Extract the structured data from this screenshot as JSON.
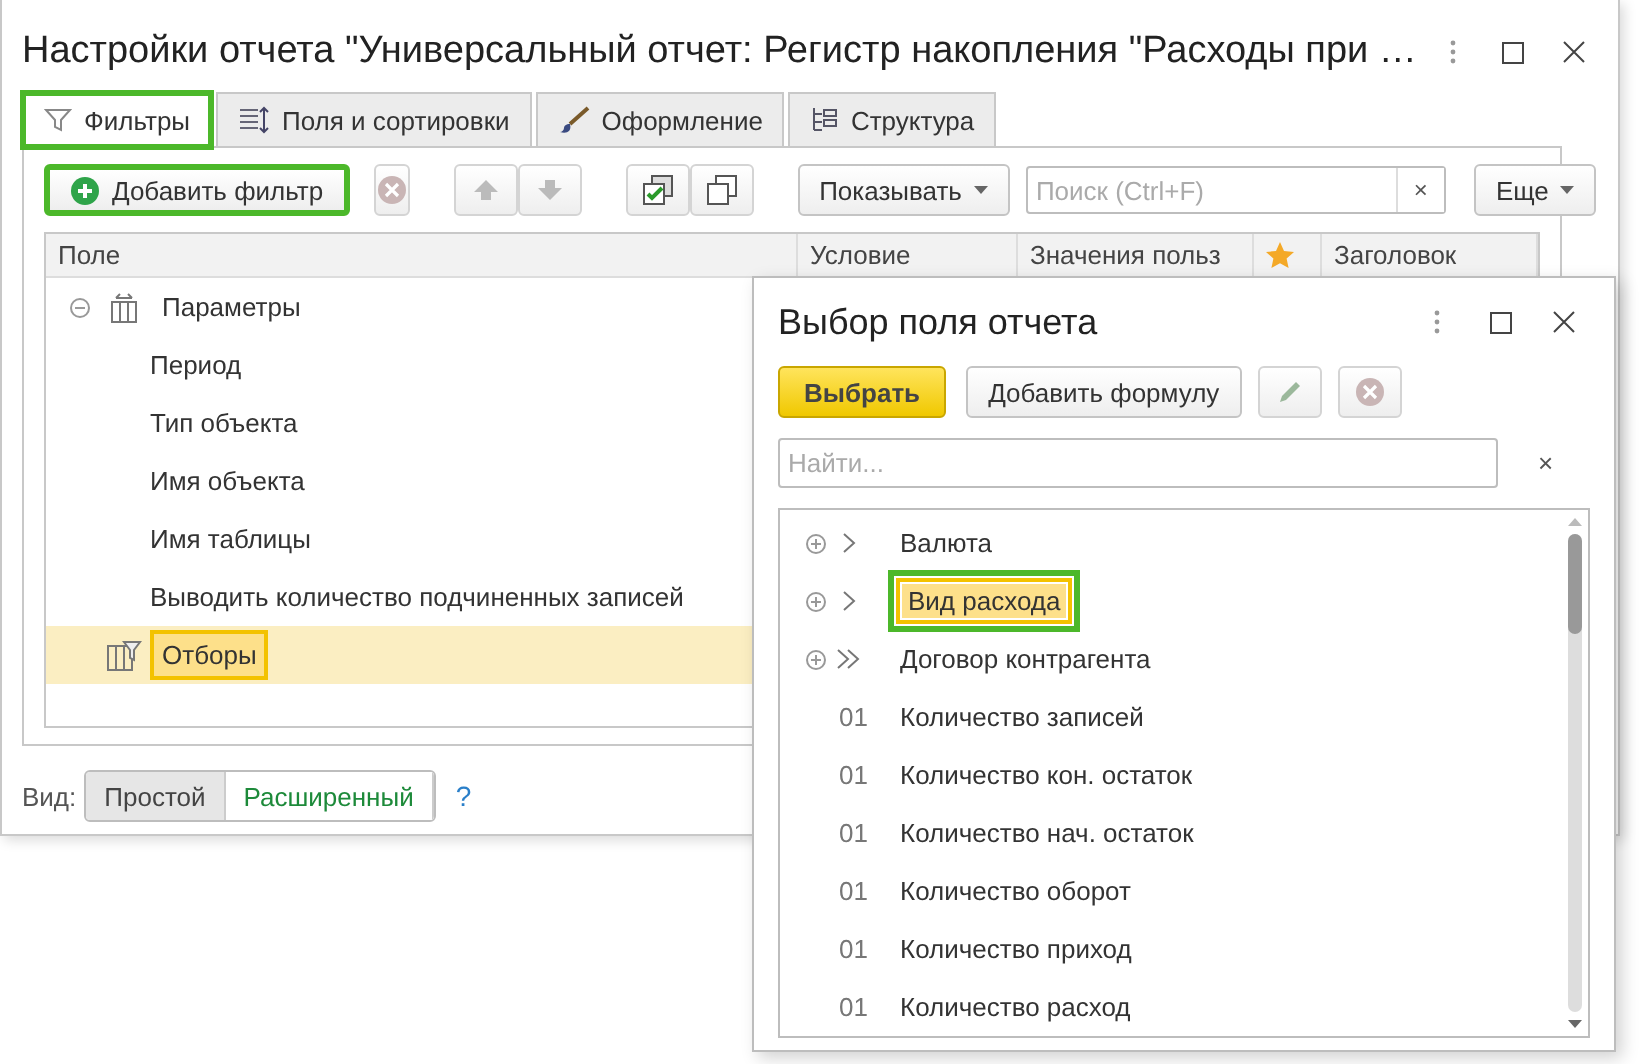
{
  "window": {
    "title": "Настройки отчета \"Универсальный отчет: Регистр накопления \"Расходы при …"
  },
  "tabs": [
    {
      "label": "Фильтры",
      "selected": true,
      "highlighted": true
    },
    {
      "label": "Поля и сортировки",
      "selected": false,
      "highlighted": false
    },
    {
      "label": "Оформление",
      "selected": false,
      "highlighted": false
    },
    {
      "label": "Структура",
      "selected": false,
      "highlighted": false
    }
  ],
  "toolbar": {
    "add_filter": {
      "label": "Добавить фильтр",
      "highlighted": true
    },
    "show": "Показывать",
    "search": {
      "placeholder": "Поиск (Ctrl+F)",
      "clear": "×"
    },
    "more": "Еще"
  },
  "table": {
    "columns": [
      "Поле",
      "Условие",
      "Значения польз",
      "Заголовок"
    ],
    "rows": [
      {
        "label": "Параметры",
        "expanded": true,
        "selected": false,
        "children": [
          {
            "label": "Период",
            "selected": false
          },
          {
            "label": "Тип объекта",
            "selected": false
          },
          {
            "label": "Имя объекта",
            "selected": false
          },
          {
            "label": "Имя таблицы",
            "selected": false
          },
          {
            "label": "Выводить количество подчиненных записей",
            "selected": false
          }
        ]
      },
      {
        "label": "Отборы",
        "selected": true
      }
    ]
  },
  "view": {
    "label": "Вид:",
    "options": [
      {
        "label": "Простой",
        "selected": true
      },
      {
        "label": "Расширенный",
        "selected": false
      }
    ],
    "help": "?"
  },
  "dialog": {
    "title": "Выбор поля отчета",
    "choose": "Выбрать",
    "add_formula": "Добавить формулу",
    "search": {
      "placeholder": "Найти...",
      "clear": "×"
    },
    "items": [
      {
        "kind": "ref",
        "label": "Валюта",
        "selected": false,
        "highlighted": false
      },
      {
        "kind": "ref",
        "label": "Вид расхода",
        "selected": true,
        "highlighted": true
      },
      {
        "kind": "link",
        "label": "Договор контрагента",
        "selected": false,
        "highlighted": false
      },
      {
        "kind": "number",
        "prefix": "01",
        "label": "Количество записей",
        "selected": false,
        "highlighted": false
      },
      {
        "kind": "number",
        "prefix": "01",
        "label": "Количество кон. остаток",
        "selected": false,
        "highlighted": false
      },
      {
        "kind": "number",
        "prefix": "01",
        "label": "Количество нач. остаток",
        "selected": false,
        "highlighted": false
      },
      {
        "kind": "number",
        "prefix": "01",
        "label": "Количество оборот",
        "selected": false,
        "highlighted": false
      },
      {
        "kind": "number",
        "prefix": "01",
        "label": "Количество приход",
        "selected": false,
        "highlighted": false
      },
      {
        "kind": "number",
        "prefix": "01",
        "label": "Количество расход",
        "selected": false,
        "highlighted": false
      }
    ]
  }
}
